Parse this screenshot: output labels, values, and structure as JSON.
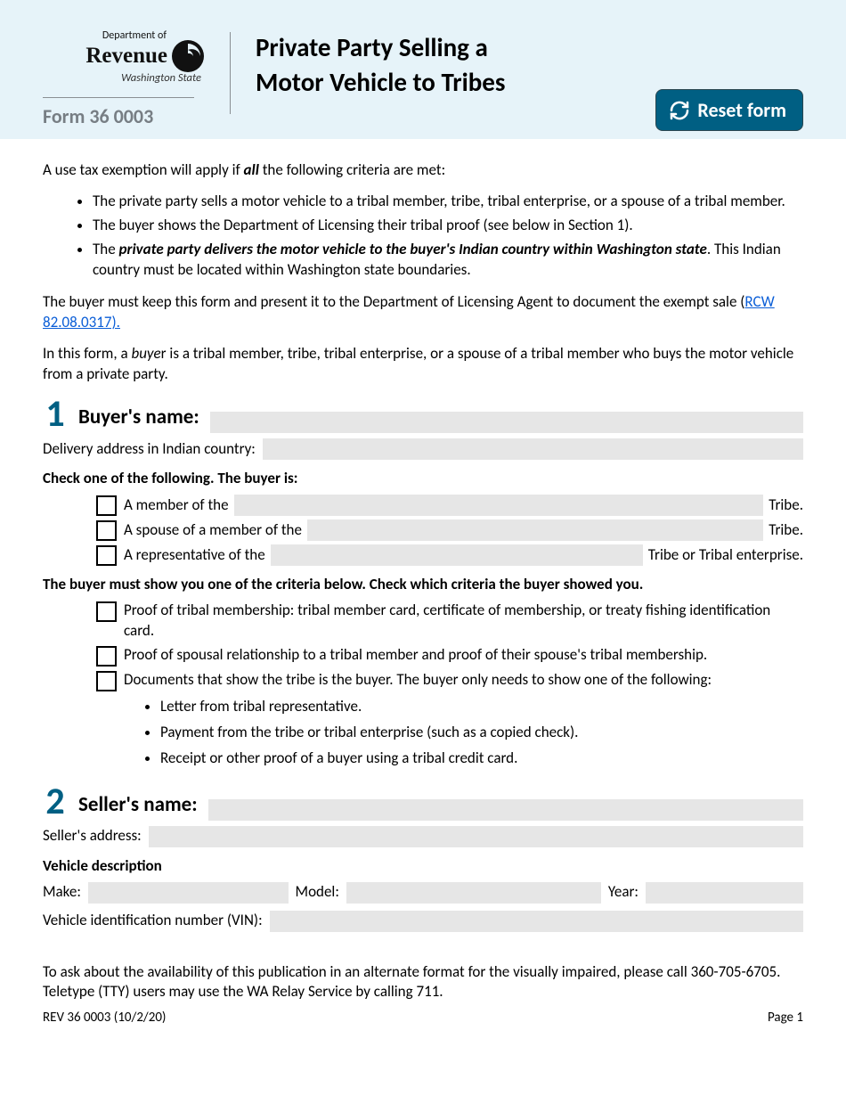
{
  "header": {
    "dept_of": "Department of",
    "revenue": "Revenue",
    "wa_state": "Washington State",
    "form_number": "Form 36 0003",
    "title_line1": "Private Party Selling a",
    "title_line2": "Motor Vehicle to Tribes",
    "reset_label": "Reset form"
  },
  "intro": {
    "lead": "A use tax exemption will apply if ",
    "lead_bold": "all",
    "lead_tail": " the following criteria are met:",
    "bullets": {
      "b1": "The private party sells a motor vehicle to a tribal member, tribe, tribal enterprise, or a spouse of a tribal member.",
      "b2": "The buyer shows the Department of Licensing their tribal proof (see below in Section 1).",
      "b3_pre": "The ",
      "b3_bold": "private party delivers the motor vehicle to the buyer's Indian country within Washington state",
      "b3_post": ". This Indian country must be located within Washington state boundaries."
    },
    "keep_pre": "The buyer must keep this form and present it to the Department of Licensing Agent to document the exempt sale (",
    "keep_link": "RCW 82.08.0317).",
    "buyer_def_pre": "In this form, a ",
    "buyer_def_italic": "buye",
    "buyer_def_post": "r is a tribal member, tribe, tribal enterprise, or a spouse of a tribal member who buys the motor vehicle from a private party."
  },
  "section1": {
    "num": "1",
    "label": "Buyer's name:",
    "delivery_label": "Delivery address in Indian country:",
    "check_one": "Check one of the following. The buyer is:",
    "opt1_text": "A member of the",
    "opt1_tail": "Tribe.",
    "opt2_text": "A spouse of a member of the",
    "opt2_tail": "Tribe.",
    "opt3_text": "A representative of the",
    "opt3_tail": "Tribe or Tribal enterprise.",
    "criteria_head": "The buyer must show you one of the criteria below. Check which criteria the buyer showed you.",
    "crit1": "Proof of tribal membership: tribal member card, certificate of membership, or treaty fishing identification card.",
    "crit2": "Proof of spousal relationship to a tribal member and proof of their spouse's tribal membership.",
    "crit3": "Documents that show the tribe is the buyer. The buyer only needs to show one of the following:",
    "sub": {
      "s1": "Letter from tribal representative.",
      "s2": "Payment from the tribe or tribal enterprise (such as a copied check).",
      "s3": "Receipt or other proof of a buyer using a tribal credit card."
    }
  },
  "section2": {
    "num": "2",
    "label": "Seller's name:",
    "addr_label": "Seller's address:",
    "veh_head": "Vehicle description",
    "make": "Make:",
    "model": "Model:",
    "year": "Year:",
    "vin": "Vehicle identification number (VIN):"
  },
  "footer": {
    "note": "To ask about the availability of this publication in an alternate format for the visually impaired, please call 360-705-6705. Teletype (TTY) users may use the WA Relay Service by calling 711.",
    "rev": "REV 36 0003  (10/2/20)",
    "page": "Page 1"
  }
}
